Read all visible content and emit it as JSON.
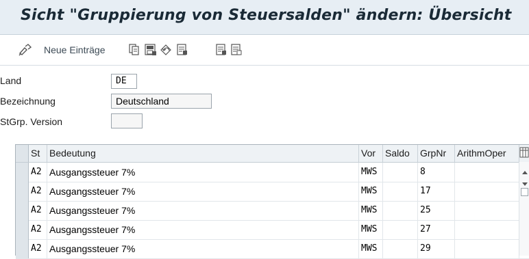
{
  "window": {
    "title": "Sicht \"Gruppierung von Steuersalden\" ändern: Übersicht"
  },
  "toolbar": {
    "new_entries_label": "Neue Einträge",
    "icons": [
      "glasses-edit-icon",
      "copy-icon",
      "save-as-icon",
      "undo-icon",
      "select-all-icon",
      "select-block-icon",
      "deselect-all-icon"
    ]
  },
  "header_fields": {
    "land": {
      "label": "Land",
      "value": "DE"
    },
    "bezeichnung": {
      "label": "Bezeichnung",
      "value": "Deutschland"
    },
    "version": {
      "label": "StGrp. Version",
      "value": ""
    }
  },
  "table": {
    "columns": [
      "St",
      "Bedeutung",
      "Vor",
      "Saldo",
      "GrpNr",
      "ArithmOper"
    ],
    "rows": [
      {
        "st": "A2",
        "bedeutung": "Ausgangssteuer 7%",
        "vor": "MWS",
        "saldo": "",
        "grpnr": "8",
        "arith": ""
      },
      {
        "st": "A2",
        "bedeutung": "Ausgangssteuer 7%",
        "vor": "MWS",
        "saldo": "",
        "grpnr": "17",
        "arith": ""
      },
      {
        "st": "A2",
        "bedeutung": "Ausgangssteuer 7%",
        "vor": "MWS",
        "saldo": "",
        "grpnr": "25",
        "arith": ""
      },
      {
        "st": "A2",
        "bedeutung": "Ausgangssteuer 7%",
        "vor": "MWS",
        "saldo": "",
        "grpnr": "27",
        "arith": ""
      },
      {
        "st": "A2",
        "bedeutung": "Ausgangssteuer 7%",
        "vor": "MWS",
        "saldo": "",
        "grpnr": "29",
        "arith": ""
      }
    ]
  },
  "colors": {
    "title_bg": "#e7eef4",
    "header_bg": "#eef2f5",
    "selector_bg": "#dfe5ea"
  }
}
